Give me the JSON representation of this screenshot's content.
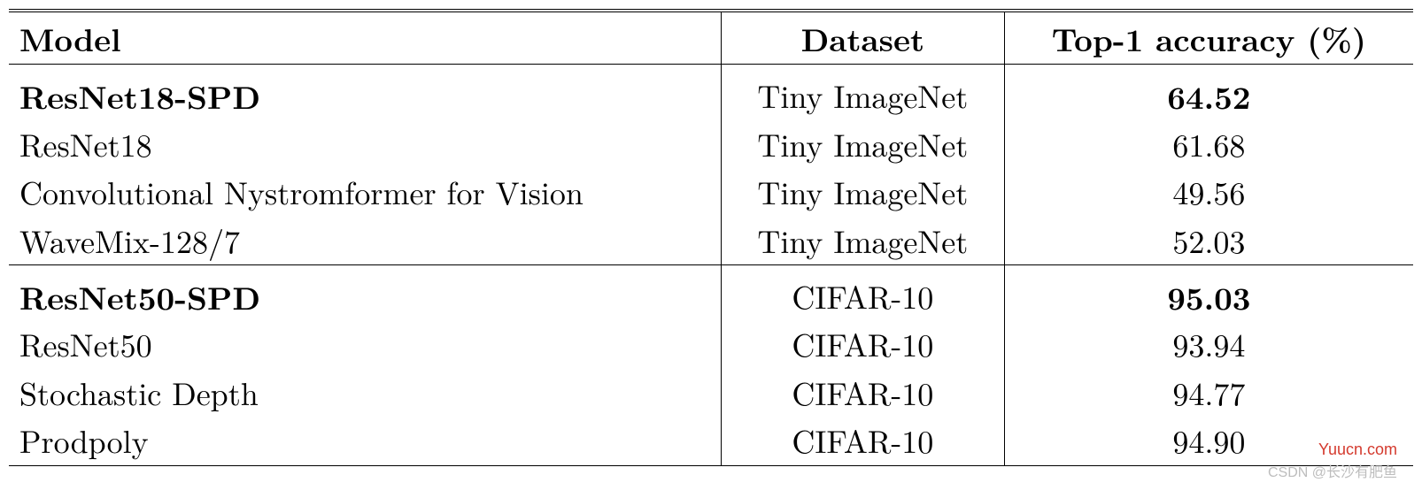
{
  "headers": {
    "model": "Model",
    "dataset": "Dataset",
    "acc": "Top-1 accuracy (%)"
  },
  "group1": [
    {
      "model": "ResNet18-SPD",
      "dataset": "Tiny ImageNet",
      "acc": "64.52",
      "bold": true
    },
    {
      "model": "ResNet18",
      "dataset": "Tiny ImageNet",
      "acc": "61.68",
      "bold": false
    },
    {
      "model": "Convolutional Nystromformer for Vision",
      "dataset": "Tiny ImageNet",
      "acc": "49.56",
      "bold": false
    },
    {
      "model": "WaveMix-128/7",
      "dataset": "Tiny ImageNet",
      "acc": "52.03",
      "bold": false
    }
  ],
  "group2": [
    {
      "model": "ResNet50-SPD",
      "dataset": "CIFAR-10",
      "acc": "95.03",
      "bold": true
    },
    {
      "model": "ResNet50",
      "dataset": "CIFAR-10",
      "acc": "93.94",
      "bold": false
    },
    {
      "model": "Stochastic Depth",
      "dataset": "CIFAR-10",
      "acc": "94.77",
      "bold": false
    },
    {
      "model": "Prodpoly",
      "dataset": "CIFAR-10",
      "acc": "94.90",
      "bold": false
    }
  ],
  "watermark1": "Yuucn.com",
  "watermark2": "CSDN @长沙有肥鱼",
  "chart_data": {
    "type": "table",
    "title": "Top-1 accuracy comparison",
    "columns": [
      "Model",
      "Dataset",
      "Top-1 accuracy (%)"
    ],
    "rows": [
      [
        "ResNet18-SPD",
        "Tiny ImageNet",
        64.52
      ],
      [
        "ResNet18",
        "Tiny ImageNet",
        61.68
      ],
      [
        "Convolutional Nystromformer for Vision",
        "Tiny ImageNet",
        49.56
      ],
      [
        "WaveMix-128/7",
        "Tiny ImageNet",
        52.03
      ],
      [
        "ResNet50-SPD",
        "CIFAR-10",
        95.03
      ],
      [
        "ResNet50",
        "CIFAR-10",
        93.94
      ],
      [
        "Stochastic Depth",
        "CIFAR-10",
        94.77
      ],
      [
        "Prodpoly",
        "CIFAR-10",
        94.9
      ]
    ]
  }
}
